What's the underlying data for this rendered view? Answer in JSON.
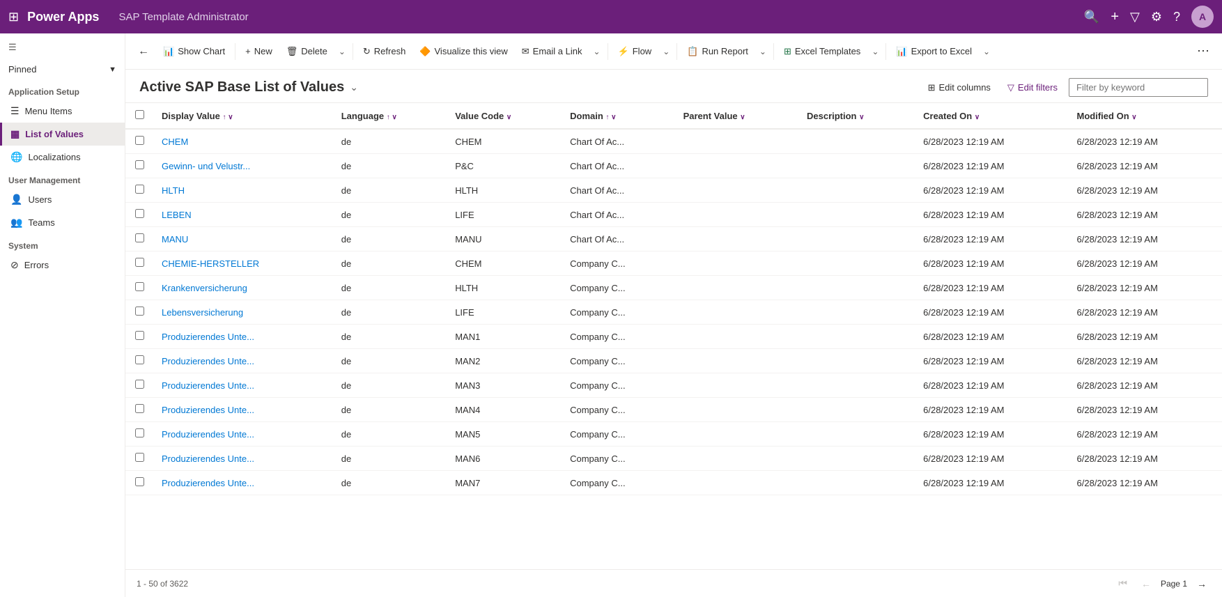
{
  "app": {
    "name": "Power Apps",
    "page_title": "SAP Template Administrator"
  },
  "topnav": {
    "search_icon": "🔍",
    "add_icon": "+",
    "filter_icon": "⧖",
    "settings_icon": "⚙",
    "help_icon": "?",
    "avatar_initials": "A"
  },
  "sidebar": {
    "pinned_label": "Pinned",
    "sections": [
      {
        "title": "Application Setup",
        "items": [
          {
            "label": "Menu Items",
            "icon": "☰",
            "active": false
          },
          {
            "label": "List of Values",
            "icon": "▦",
            "active": true
          },
          {
            "label": "Localizations",
            "icon": "🌐",
            "active": false
          }
        ]
      },
      {
        "title": "User Management",
        "items": [
          {
            "label": "Users",
            "icon": "👤",
            "active": false
          },
          {
            "label": "Teams",
            "icon": "👥",
            "active": false
          }
        ]
      },
      {
        "title": "System",
        "items": [
          {
            "label": "Errors",
            "icon": "⊘",
            "active": false
          }
        ]
      }
    ]
  },
  "toolbar": {
    "back_label": "←",
    "show_chart_label": "Show Chart",
    "new_label": "New",
    "delete_label": "Delete",
    "refresh_label": "Refresh",
    "visualize_label": "Visualize this view",
    "email_label": "Email a Link",
    "flow_label": "Flow",
    "run_report_label": "Run Report",
    "excel_templates_label": "Excel Templates",
    "export_excel_label": "Export to Excel",
    "more_label": "⋯"
  },
  "view": {
    "title": "Active SAP Base List of Values",
    "edit_columns_label": "Edit columns",
    "edit_filters_label": "Edit filters",
    "filter_placeholder": "Filter by keyword"
  },
  "table": {
    "columns": [
      {
        "label": "Display Value",
        "sortable": true,
        "sort": "asc"
      },
      {
        "label": "Language",
        "sortable": true,
        "sort": "asc"
      },
      {
        "label": "Value Code",
        "sortable": true,
        "sort": "desc"
      },
      {
        "label": "Domain",
        "sortable": true,
        "sort": "asc"
      },
      {
        "label": "Parent Value",
        "sortable": true,
        "sort": "desc"
      },
      {
        "label": "Description",
        "sortable": true,
        "sort": "desc"
      },
      {
        "label": "Created On",
        "sortable": true,
        "sort": "desc"
      },
      {
        "label": "Modified On",
        "sortable": true,
        "sort": "desc"
      }
    ],
    "rows": [
      {
        "display_value": "CHEM",
        "language": "de",
        "value_code": "CHEM",
        "domain": "Chart Of Ac...",
        "parent_value": "",
        "description": "",
        "created_on": "6/28/2023 12:19 AM",
        "modified_on": "6/28/2023 12:19 AM"
      },
      {
        "display_value": "Gewinn- und Velustr...",
        "language": "de",
        "value_code": "P&C",
        "domain": "Chart Of Ac...",
        "parent_value": "",
        "description": "",
        "created_on": "6/28/2023 12:19 AM",
        "modified_on": "6/28/2023 12:19 AM"
      },
      {
        "display_value": "HLTH",
        "language": "de",
        "value_code": "HLTH",
        "domain": "Chart Of Ac...",
        "parent_value": "",
        "description": "",
        "created_on": "6/28/2023 12:19 AM",
        "modified_on": "6/28/2023 12:19 AM"
      },
      {
        "display_value": "LEBEN",
        "language": "de",
        "value_code": "LIFE",
        "domain": "Chart Of Ac...",
        "parent_value": "",
        "description": "",
        "created_on": "6/28/2023 12:19 AM",
        "modified_on": "6/28/2023 12:19 AM"
      },
      {
        "display_value": "MANU",
        "language": "de",
        "value_code": "MANU",
        "domain": "Chart Of Ac...",
        "parent_value": "",
        "description": "",
        "created_on": "6/28/2023 12:19 AM",
        "modified_on": "6/28/2023 12:19 AM"
      },
      {
        "display_value": "CHEMIE-HERSTELLER",
        "language": "de",
        "value_code": "CHEM",
        "domain": "Company C...",
        "parent_value": "",
        "description": "",
        "created_on": "6/28/2023 12:19 AM",
        "modified_on": "6/28/2023 12:19 AM"
      },
      {
        "display_value": "Krankenversicherung",
        "language": "de",
        "value_code": "HLTH",
        "domain": "Company C...",
        "parent_value": "",
        "description": "",
        "created_on": "6/28/2023 12:19 AM",
        "modified_on": "6/28/2023 12:19 AM"
      },
      {
        "display_value": "Lebensversicherung",
        "language": "de",
        "value_code": "LIFE",
        "domain": "Company C...",
        "parent_value": "",
        "description": "",
        "created_on": "6/28/2023 12:19 AM",
        "modified_on": "6/28/2023 12:19 AM"
      },
      {
        "display_value": "Produzierendes Unte...",
        "language": "de",
        "value_code": "MAN1",
        "domain": "Company C...",
        "parent_value": "",
        "description": "",
        "created_on": "6/28/2023 12:19 AM",
        "modified_on": "6/28/2023 12:19 AM"
      },
      {
        "display_value": "Produzierendes Unte...",
        "language": "de",
        "value_code": "MAN2",
        "domain": "Company C...",
        "parent_value": "",
        "description": "",
        "created_on": "6/28/2023 12:19 AM",
        "modified_on": "6/28/2023 12:19 AM"
      },
      {
        "display_value": "Produzierendes Unte...",
        "language": "de",
        "value_code": "MAN3",
        "domain": "Company C...",
        "parent_value": "",
        "description": "",
        "created_on": "6/28/2023 12:19 AM",
        "modified_on": "6/28/2023 12:19 AM"
      },
      {
        "display_value": "Produzierendes Unte...",
        "language": "de",
        "value_code": "MAN4",
        "domain": "Company C...",
        "parent_value": "",
        "description": "",
        "created_on": "6/28/2023 12:19 AM",
        "modified_on": "6/28/2023 12:19 AM"
      },
      {
        "display_value": "Produzierendes Unte...",
        "language": "de",
        "value_code": "MAN5",
        "domain": "Company C...",
        "parent_value": "",
        "description": "",
        "created_on": "6/28/2023 12:19 AM",
        "modified_on": "6/28/2023 12:19 AM"
      },
      {
        "display_value": "Produzierendes Unte...",
        "language": "de",
        "value_code": "MAN6",
        "domain": "Company C...",
        "parent_value": "",
        "description": "",
        "created_on": "6/28/2023 12:19 AM",
        "modified_on": "6/28/2023 12:19 AM"
      },
      {
        "display_value": "Produzierendes Unte...",
        "language": "de",
        "value_code": "MAN7",
        "domain": "Company C...",
        "parent_value": "",
        "description": "",
        "created_on": "6/28/2023 12:19 AM",
        "modified_on": "6/28/2023 12:19 AM"
      }
    ]
  },
  "footer": {
    "record_count": "1 - 50 of 3622",
    "page_label": "Page 1"
  }
}
